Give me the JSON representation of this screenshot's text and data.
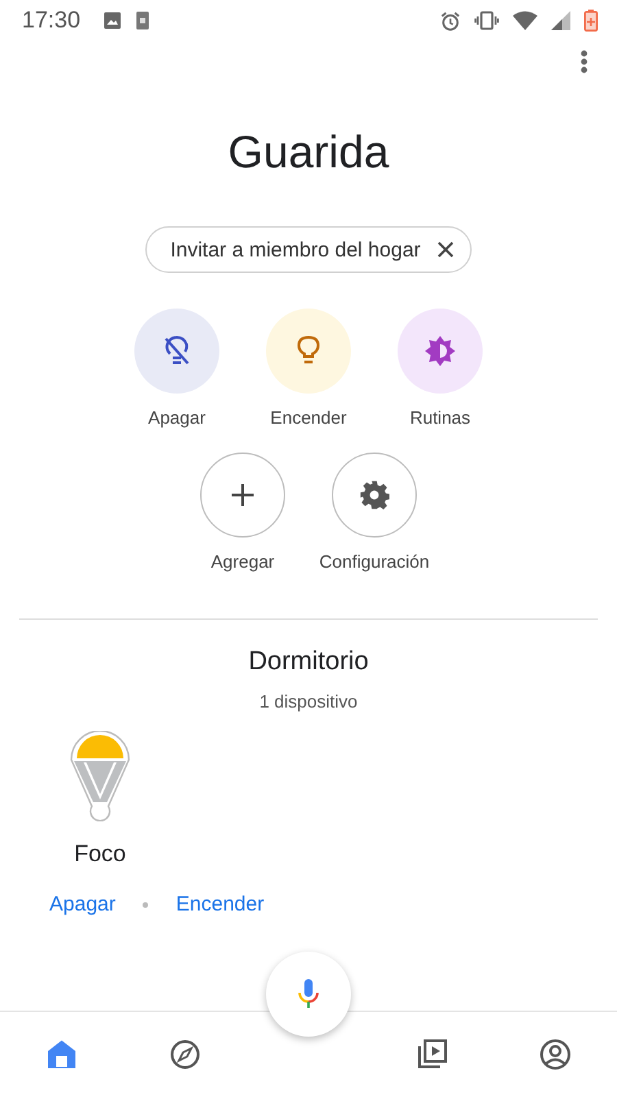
{
  "status_bar": {
    "time": "17:30"
  },
  "home": {
    "title": "Guarida",
    "invite_chip": {
      "label": "Invitar a miembro del hogar"
    }
  },
  "actions": [
    {
      "kind": "off",
      "label": "Apagar"
    },
    {
      "kind": "on",
      "label": "Encender"
    },
    {
      "kind": "routines",
      "label": "Rutinas"
    },
    {
      "kind": "add",
      "label": "Agregar"
    },
    {
      "kind": "settings",
      "label": "Configuración"
    }
  ],
  "room": {
    "name": "Dormitorio",
    "count": "1 dispositivo",
    "devices": [
      {
        "name": "Foco",
        "on": true,
        "links": [
          "Apagar",
          "Encender"
        ]
      }
    ]
  },
  "bottom_nav": [
    {
      "kind": "home",
      "selected": true
    },
    {
      "kind": "discover",
      "selected": false
    },
    {
      "kind": "media",
      "selected": false
    },
    {
      "kind": "account",
      "selected": false
    }
  ]
}
